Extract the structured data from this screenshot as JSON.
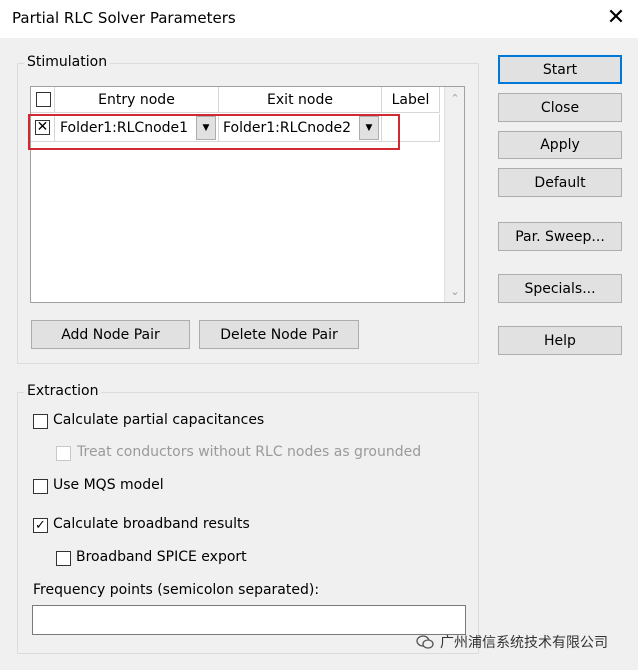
{
  "window": {
    "title": "Partial RLC Solver Parameters",
    "close_glyph": "✕"
  },
  "stimulation": {
    "label": "Stimulation",
    "columns": {
      "entry": "Entry node",
      "exit": "Exit node",
      "label": "Label"
    },
    "rows": [
      {
        "checked": true,
        "entry": "Folder1:RLCnode1",
        "exit": "Folder1:RLCnode2",
        "label": ""
      }
    ],
    "add_button": "Add Node Pair",
    "delete_button": "Delete Node Pair"
  },
  "extraction": {
    "label": "Extraction",
    "partial_cap": {
      "label": "Calculate partial capacitances",
      "checked": false
    },
    "treat_grounded": {
      "label": "Treat conductors without RLC nodes as grounded",
      "checked": false,
      "disabled": true
    },
    "mqs": {
      "label": "Use MQS model",
      "checked": false
    },
    "broadband": {
      "label": "Calculate broadband results",
      "checked": true
    },
    "spice": {
      "label": "Broadband SPICE export",
      "checked": false
    },
    "freq_label": "Frequency points (semicolon separated):",
    "freq_value": ""
  },
  "buttons": {
    "start": "Start",
    "close": "Close",
    "apply": "Apply",
    "default": "Default",
    "par_sweep": "Par. Sweep...",
    "specials": "Specials...",
    "help": "Help"
  },
  "watermark": {
    "text": "广州浦信系统技术有限公司",
    "icon": "wechat-icon"
  },
  "colors": {
    "highlight_border": "#d0292f",
    "default_button_border": "#0078d7"
  }
}
